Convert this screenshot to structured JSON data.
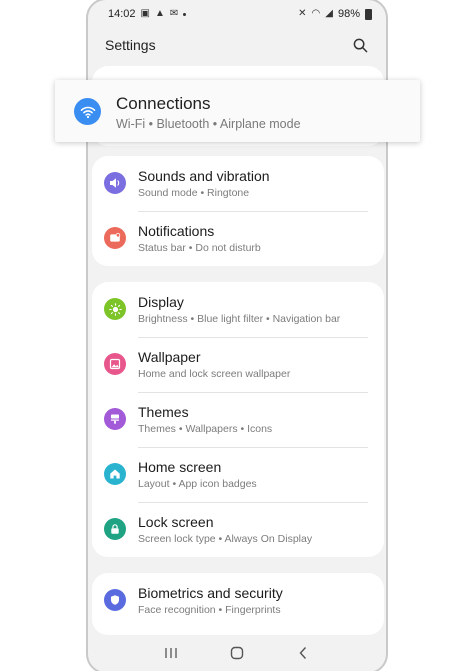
{
  "status_bar": {
    "time": "14:02",
    "battery": "98%"
  },
  "app_bar": {
    "title": "Settings"
  },
  "connections": {
    "label": "Connections",
    "sub": "Wi-Fi  •  Bluetooth  •  Airplane mode",
    "icon": "wifi-icon",
    "color": "#3a8ef2"
  },
  "groups": [
    {
      "items": [
        {
          "label": "Sounds and vibration",
          "sub": "Sound mode  •  Ringtone",
          "icon": "speaker-icon",
          "color": "#7b6ee0"
        },
        {
          "label": "Notifications",
          "sub": "Status bar  •  Do not disturb",
          "icon": "notification-icon",
          "color": "#ec6a5c"
        }
      ]
    },
    {
      "items": [
        {
          "label": "Display",
          "sub": "Brightness  •  Blue light filter  •  Navigation bar",
          "icon": "sun-icon",
          "color": "#7cc427"
        },
        {
          "label": "Wallpaper",
          "sub": "Home and lock screen wallpaper",
          "icon": "image-icon",
          "color": "#e8578b"
        },
        {
          "label": "Themes",
          "sub": "Themes  •  Wallpapers  •  Icons",
          "icon": "brush-icon",
          "color": "#a35ad9"
        },
        {
          "label": "Home screen",
          "sub": "Layout  •  App icon badges",
          "icon": "home-icon",
          "color": "#2ab3cf"
        },
        {
          "label": "Lock screen",
          "sub": "Screen lock type  •  Always On Display",
          "icon": "lock-icon",
          "color": "#1fa383"
        }
      ]
    },
    {
      "items": [
        {
          "label": "Biometrics and security",
          "sub": "Face recognition  •  Fingerprints",
          "icon": "shield-icon",
          "color": "#5a6be0"
        }
      ]
    }
  ]
}
